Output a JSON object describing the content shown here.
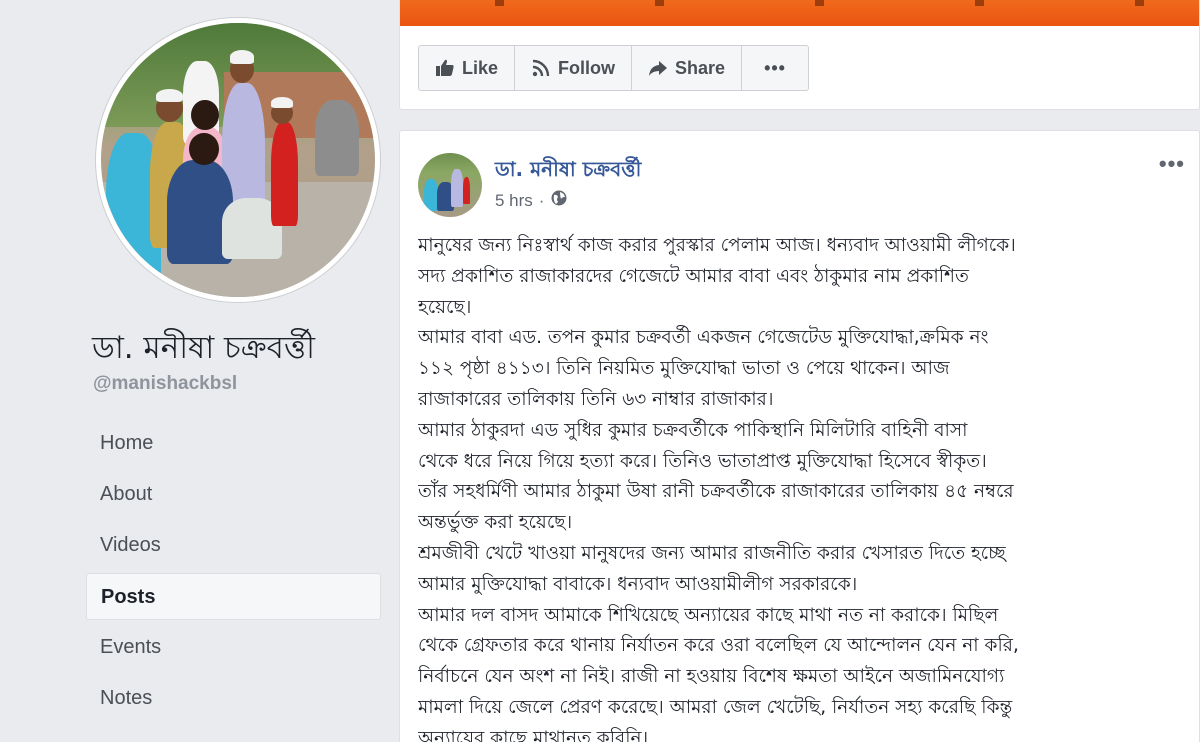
{
  "profile": {
    "name": "ডা. মনীষা চক্রবর্ত্তী",
    "username": "@manishackbsl"
  },
  "sidebar": {
    "items": [
      {
        "label": "Home"
      },
      {
        "label": "About"
      },
      {
        "label": "Videos"
      },
      {
        "label": "Posts"
      },
      {
        "label": "Events"
      },
      {
        "label": "Notes"
      }
    ],
    "active": "Posts"
  },
  "actions": {
    "like": "Like",
    "follow": "Follow",
    "share": "Share",
    "more": "•••"
  },
  "post": {
    "author": "ডা. মনীষা চক্রবর্ত্তী",
    "time": "5 hrs",
    "menu": "•••",
    "lines": [
      "মানুষের জন্য নিঃস্বার্থ কাজ করার পুরস্কার পেলাম আজ। ধন্যবাদ আওয়ামী লীগকে।",
      "সদ্য প্রকাশিত রাজাকারদের গেজেটে আমার বাবা এবং ঠাকুমার নাম প্রকাশিত",
      "হয়েছে।",
      "আমার বাবা এড. তপন কুমার চক্রবর্তী একজন গেজেটেড মুক্তিযোদ্ধা,ক্রমিক নং",
      "১১২ পৃষ্ঠা ৪১১৩। তিনি নিয়মিত মুক্তিযোদ্ধা ভাতা ও পেয়ে থাকেন। আজ",
      "রাজাকারের তালিকায় তিনি ৬৩ নাম্বার রাজাকার।",
      "আমার ঠাকুরদা এড সুধির কুমার চক্রবর্তীকে পাকিস্থানি মিলিটারি বাহিনী বাসা",
      "থেকে ধরে নিয়ে গিয়ে হত্যা করে। তিনিও ভাতাপ্রাপ্ত মুক্তিযোদ্ধা হিসেবে স্বীকৃত।",
      "তাঁর সহধর্মিণী আমার ঠাকুমা উষা রানী চক্রবর্তীকে রাজাকারের তালিকায় ৪৫ নম্বরে",
      "অন্তর্ভুক্ত করা হয়েছে।",
      "শ্রমজীবী খেটে খাওয়া মানুষদের জন্য আমার রাজনীতি করার খেসারত দিতে হচ্ছে",
      "আমার মুক্তিযোদ্ধা বাবাকে। ধন্যবাদ আওয়ামীলীগ সরকারকে।",
      "আমার দল বাসদ আমাকে শিখিয়েছে অন্যায়ের কাছে মাথা নত না করাকে। মিছিল",
      "থেকে গ্রেফতার করে থানায় নির্যাতন করে ওরা বলেছিল যে আন্দোলন যেন না করি,",
      "নির্বাচনে যেন অংশ না নিই। রাজী না হওয়ায় বিশেষ ক্ষমতা আইনে অজামিনযোগ্য",
      "মামলা দিয়ে জেলে প্রেরণ করেছে। আমরা জেল খেটেছি, নির্যাতন সহ্য করেছি কিন্তু",
      "অন্যায়ের কাছে মাথানত করিনি।"
    ]
  },
  "colors": {
    "accent": "#365899",
    "cover": "#ea5410",
    "background": "#e9ebee"
  }
}
